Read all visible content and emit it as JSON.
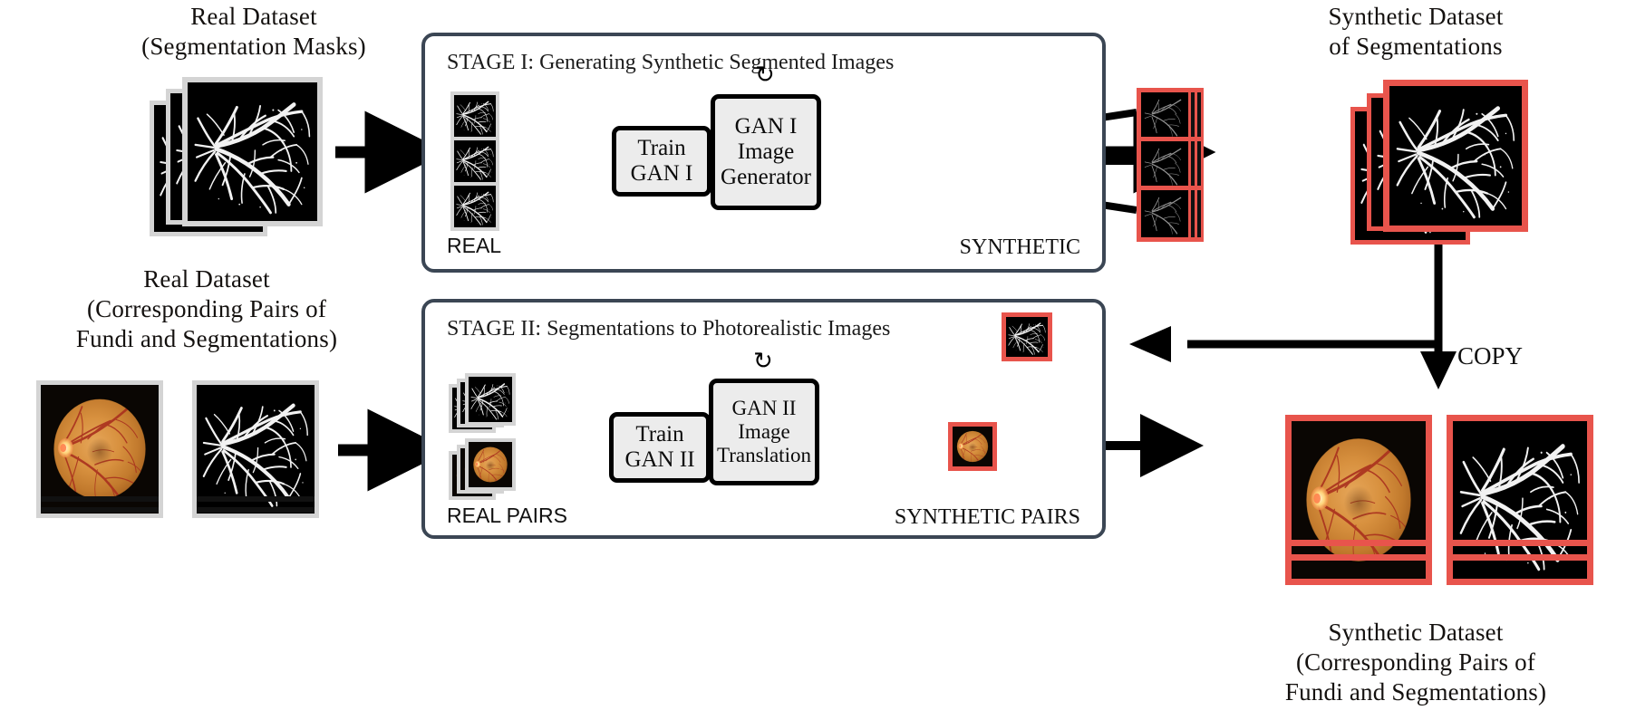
{
  "figure": {
    "title": "Two-stage GAN pipeline for synthetic retinal fundus generation",
    "accent_red": "#e8544c",
    "stage_border": "#3b4654",
    "box_fill": "#ececec",
    "real_border": "#d4d4d4"
  },
  "captions": {
    "top_left": "Real Dataset\n(Segmentation Masks)",
    "mid_left": "Real Dataset\n(Corresponding Pairs of\nFundi and Segmentations)",
    "top_right": "Synthetic Dataset\nof Segmentations",
    "bottom_right": "Synthetic Dataset\n(Corresponding Pairs of\nFundi and Segmentations)",
    "copy": "COPY"
  },
  "stage1": {
    "title": "STAGE I: Generating Synthetic Segmented Images",
    "train_box": [
      "Train",
      "GAN I"
    ],
    "gen_box": [
      "GAN I",
      "Image",
      "Generator"
    ],
    "left_label": "REAL",
    "right_label": "SYNTHETIC",
    "recycle_icon": "↻",
    "input_count": 3,
    "output_count": 3
  },
  "stage2": {
    "title": "STAGE II: Segmentations to Photorealistic Images",
    "train_box": [
      "Train",
      "GAN II"
    ],
    "gen_box": [
      "GAN II",
      "Image",
      "Translation"
    ],
    "left_label": "REAL PAIRS",
    "right_label": "SYNTHETIC PAIRS",
    "recycle_icon": "↻"
  },
  "icons": {
    "recycle": "recycle-icon",
    "arrow": "arrow-right-icon"
  }
}
